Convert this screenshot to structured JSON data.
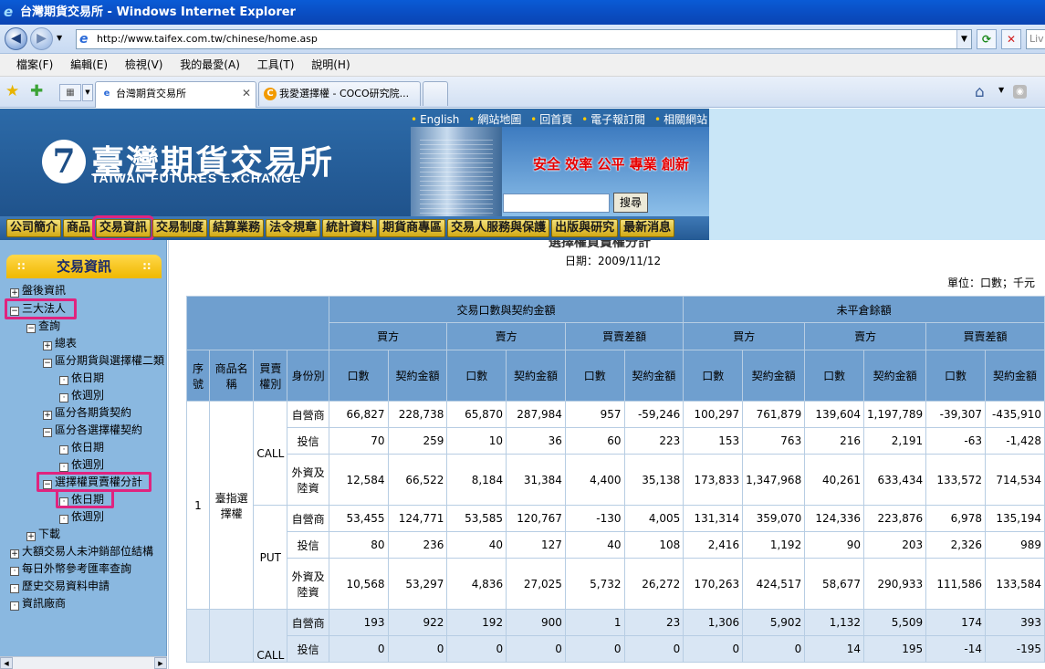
{
  "window": {
    "title": "台灣期貨交易所 - Windows Internet Explorer"
  },
  "address": {
    "url": "http://www.taifex.com.tw/chinese/home.asp",
    "search_placeholder": "Liv"
  },
  "menu": [
    "檔案(F)",
    "編輯(E)",
    "檢視(V)",
    "我的最愛(A)",
    "工具(T)",
    "說明(H)"
  ],
  "tabs": [
    {
      "label": "台灣期貨交易所"
    },
    {
      "label": "我愛選擇權 - COCO研究院..."
    }
  ],
  "header": {
    "logo_cn": "臺灣期貨交易所",
    "logo_en": "TAIWAN FUTURES EXCHANGE",
    "top_links": [
      "English",
      "網站地圖",
      "回首頁",
      "電子報訂閱",
      "相關網站"
    ],
    "slogan": "安全 效率 公平 專業 創新",
    "search_button": "搜尋"
  },
  "main_nav": [
    "公司簡介",
    "商品",
    "交易資訊",
    "交易制度",
    "結算業務",
    "法令規章",
    "統計資料",
    "期貨商專區",
    "交易人服務與保護",
    "出版與研究",
    "最新消息"
  ],
  "sidebar": {
    "title": "交易資訊",
    "tree": [
      {
        "label": "盤後資訊",
        "sign": "+"
      },
      {
        "label": "三大法人",
        "sign": "−"
      },
      {
        "label": "查詢",
        "sign": "−"
      },
      {
        "label": "總表",
        "sign": "+"
      },
      {
        "label": "區分期貨與選擇權二類",
        "sign": "−"
      },
      {
        "label": "依日期",
        "sign": "·"
      },
      {
        "label": "依週別",
        "sign": "·"
      },
      {
        "label": "區分各期貨契約",
        "sign": "+"
      },
      {
        "label": "區分各選擇權契約",
        "sign": "−"
      },
      {
        "label": "依日期",
        "sign": "·"
      },
      {
        "label": "依週別",
        "sign": "·"
      },
      {
        "label": "選擇權買賣權分計",
        "sign": "−"
      },
      {
        "label": "依日期",
        "sign": "·"
      },
      {
        "label": "依週別",
        "sign": "·"
      },
      {
        "label": "下載",
        "sign": "+"
      },
      {
        "label": "大額交易人未沖銷部位結構",
        "sign": "+"
      },
      {
        "label": "每日外幣參考匯率查詢",
        "sign": "·"
      },
      {
        "label": "歷史交易資料申請",
        "sign": "·"
      },
      {
        "label": "資訊廠商",
        "sign": "·"
      }
    ]
  },
  "report": {
    "title": "選擇權買賣權分計",
    "date": "日期：2009/11/12",
    "unit": "單位：口數；千元",
    "group_headers": [
      "交易口數與契約金額",
      "未平倉餘額"
    ],
    "sub_headers": [
      "買方",
      "賣方",
      "買賣差額",
      "買方",
      "賣方",
      "買賣差額"
    ],
    "col_headers": [
      "序號",
      "商品名稱",
      "買賣權別",
      "身份別",
      "口數",
      "契約金額",
      "口數",
      "契約金額",
      "口數",
      "契約金額",
      "口數",
      "契約金額",
      "口數",
      "契約金額",
      "口數",
      "契約金額"
    ],
    "rows": [
      {
        "type": "自營商",
        "vals": [
          "66,827",
          "228,738",
          "65,870",
          "287,984",
          "957",
          "-59,246",
          "100,297",
          "761,879",
          "139,604",
          "1,197,789",
          "-39,307",
          "-435,910"
        ]
      },
      {
        "type": "投信",
        "vals": [
          "70",
          "259",
          "10",
          "36",
          "60",
          "223",
          "153",
          "763",
          "216",
          "2,191",
          "-63",
          "-1,428"
        ]
      },
      {
        "type": "外資及陸資",
        "vals": [
          "12,584",
          "66,522",
          "8,184",
          "31,384",
          "4,400",
          "35,138",
          "173,833",
          "1,347,968",
          "40,261",
          "633,434",
          "133,572",
          "714,534"
        ]
      },
      {
        "type": "自營商",
        "vals": [
          "53,455",
          "124,771",
          "53,585",
          "120,767",
          "-130",
          "4,005",
          "131,314",
          "359,070",
          "124,336",
          "223,876",
          "6,978",
          "135,194"
        ]
      },
      {
        "type": "投信",
        "vals": [
          "80",
          "236",
          "40",
          "127",
          "40",
          "108",
          "2,416",
          "1,192",
          "90",
          "203",
          "2,326",
          "989"
        ]
      },
      {
        "type": "外資及陸資",
        "vals": [
          "10,568",
          "53,297",
          "4,836",
          "27,025",
          "5,732",
          "26,272",
          "170,263",
          "424,517",
          "58,677",
          "290,933",
          "111,586",
          "133,584"
        ]
      },
      {
        "type": "自營商",
        "vals": [
          "193",
          "922",
          "192",
          "900",
          "1",
          "23",
          "1,306",
          "5,902",
          "1,132",
          "5,509",
          "174",
          "393"
        ]
      },
      {
        "type": "投信",
        "vals": [
          "0",
          "0",
          "0",
          "0",
          "0",
          "0",
          "0",
          "0",
          "14",
          "195",
          "-14",
          "-195"
        ]
      }
    ],
    "group1": {
      "seq": "1",
      "product": "臺指選擇權",
      "call": "CALL",
      "put": "PUT"
    },
    "group2": {
      "call": "CALL"
    }
  }
}
